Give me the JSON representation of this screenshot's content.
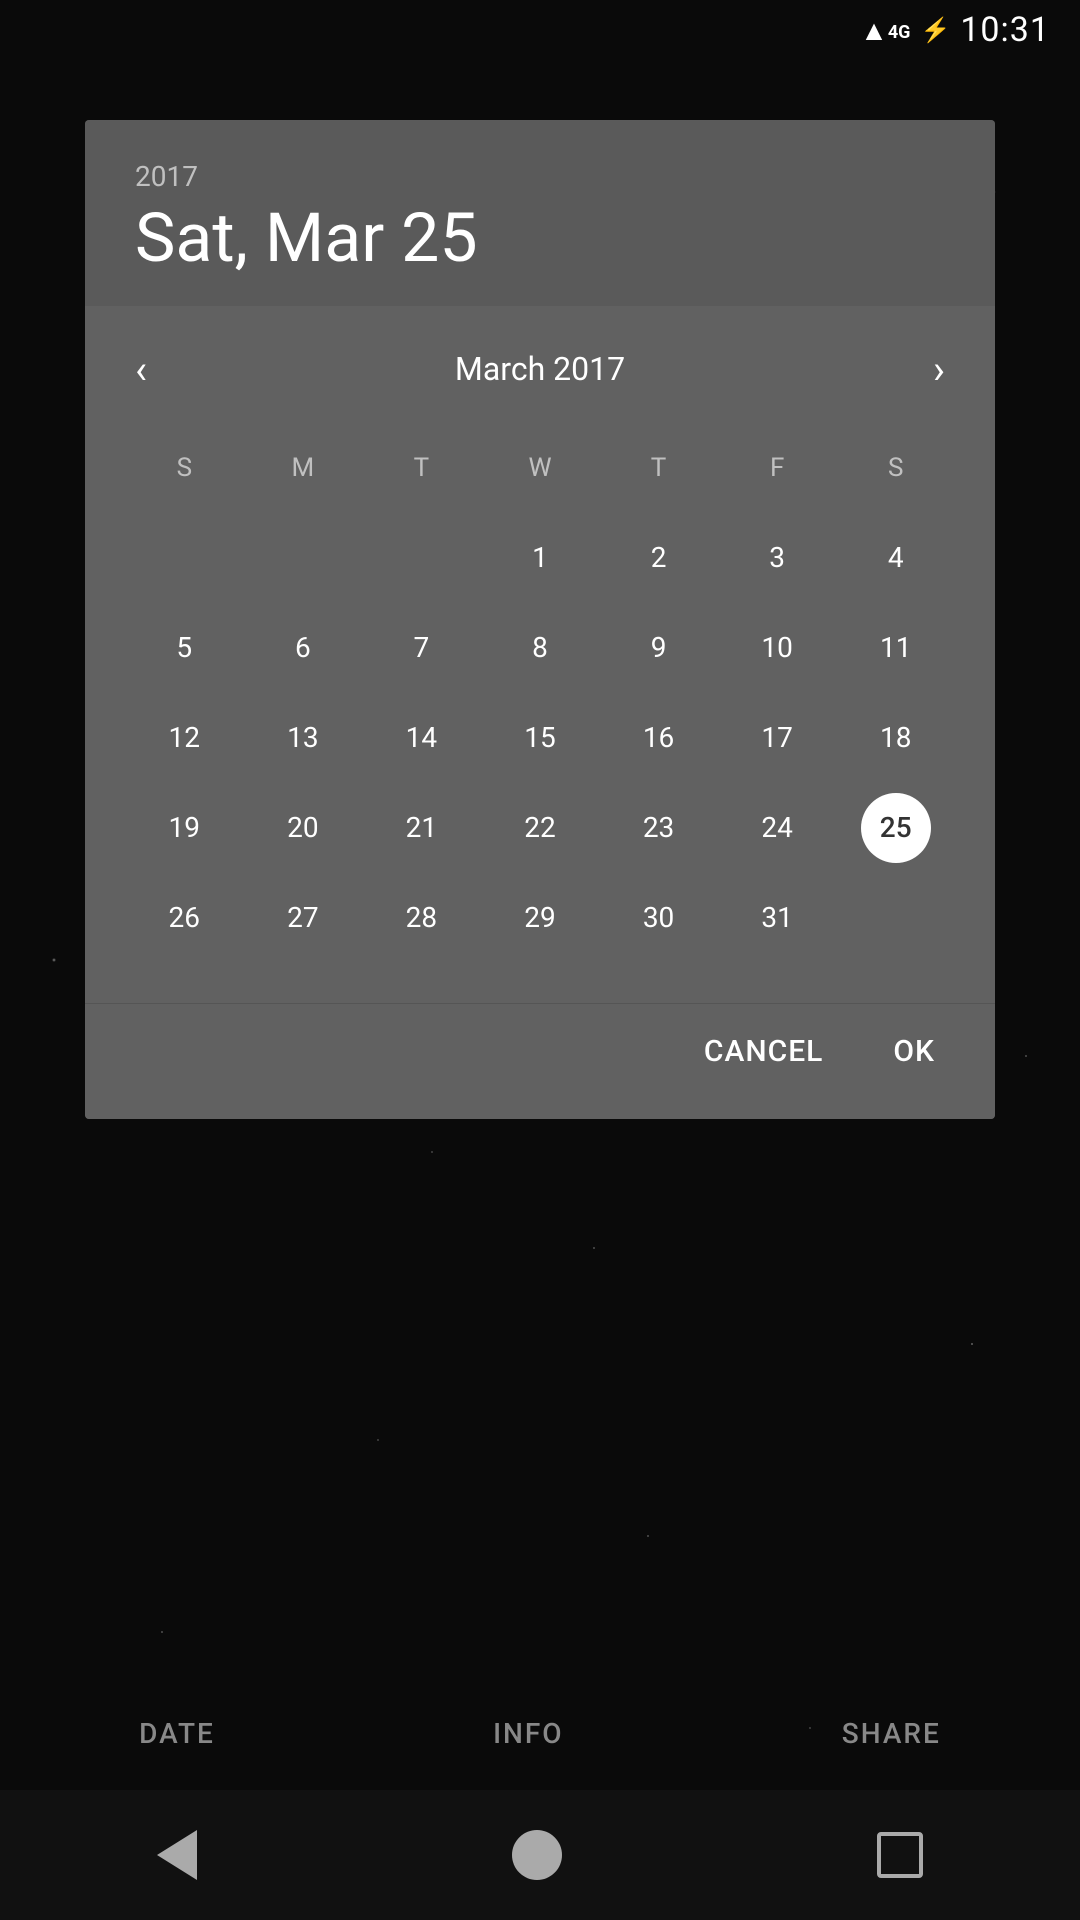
{
  "statusBar": {
    "network": "4G",
    "time": "10:31"
  },
  "dialog": {
    "year": "2017",
    "selectedDate": "Sat, Mar 25",
    "monthLabel": "March 2017",
    "selectedDay": 25,
    "dayHeaders": [
      "S",
      "M",
      "T",
      "W",
      "T",
      "F",
      "S"
    ],
    "weeks": [
      [
        null,
        null,
        null,
        1,
        2,
        3,
        4
      ],
      [
        5,
        6,
        7,
        8,
        9,
        10,
        11
      ],
      [
        12,
        13,
        14,
        15,
        16,
        17,
        18
      ],
      [
        19,
        20,
        21,
        22,
        23,
        24,
        25
      ],
      [
        26,
        27,
        28,
        29,
        30,
        31,
        null
      ]
    ],
    "cancelLabel": "CANCEL",
    "okLabel": "OK"
  },
  "bottomTabs": {
    "tabs": [
      "DATE",
      "INFO",
      "SHARE"
    ]
  },
  "navBar": {
    "back": "back",
    "home": "home",
    "recents": "recents"
  }
}
